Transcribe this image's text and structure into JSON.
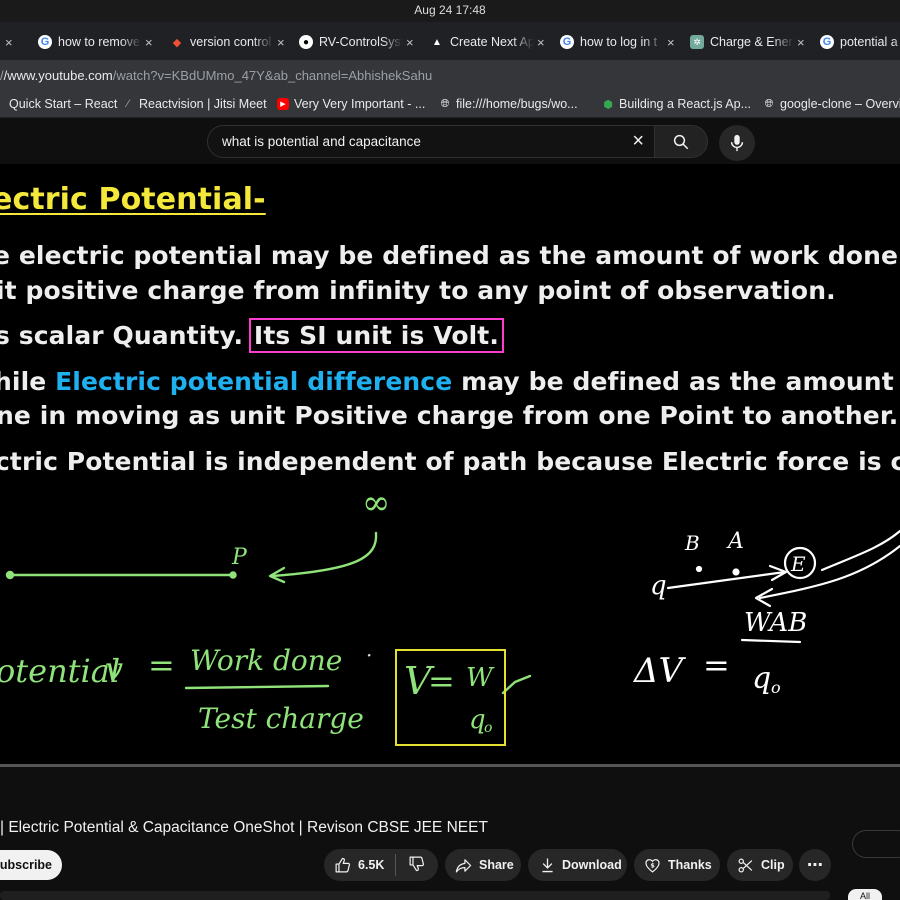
{
  "system": {
    "clock": "Aug 24  17:48"
  },
  "tabs": [
    {
      "icon": "partial-icon",
      "title": "",
      "close": "×"
    },
    {
      "icon": "google-icon",
      "title": "how to remove",
      "close": "×"
    },
    {
      "icon": "git-icon",
      "title": "version control",
      "close": "×"
    },
    {
      "icon": "github-icon",
      "title": "RV-ControlSyst",
      "close": "×"
    },
    {
      "icon": "vercel-icon",
      "title": "Create Next Ap",
      "close": "×"
    },
    {
      "icon": "google-icon",
      "title": "how to log in t",
      "close": "×"
    },
    {
      "icon": "chatgpt-icon",
      "title": "Charge & Energ",
      "close": "×"
    },
    {
      "icon": "google-icon",
      "title": "potential a",
      "close": ""
    }
  ],
  "address": {
    "prefix": "/",
    "host": "/www.youtube.com",
    "path": "/watch?v=KBdUMmo_47Y&ab_channel=AbhishekSahu"
  },
  "bookmarks": [
    {
      "icon": "partial-icon",
      "label": "Quick Start – React"
    },
    {
      "icon": "slash-icon",
      "label": "Reactvision | Jitsi Meet"
    },
    {
      "icon": "youtube-icon",
      "label": "Very Very Important - ..."
    },
    {
      "icon": "globe-icon",
      "label": "file:///home/bugs/wo..."
    },
    {
      "icon": "shield-icon",
      "label": "Building a React.js Ap..."
    },
    {
      "icon": "globe-icon",
      "label": "google-clone – Overvi"
    }
  ],
  "search": {
    "value": "what is potential and capacitance",
    "clear": "×"
  },
  "video_frame": {
    "heading": "ectric Potential-",
    "line1": "e electric potential may be defined as the amount of work done in mo",
    "line2": "it positive charge from infinity to any point of observation.",
    "line3_pre": "s scalar Quantity. ",
    "line3_box": "Its SI unit is Volt.",
    "line4_pre": "hile ",
    "line4_blue": "Electric potential difference",
    "line4_post": " may be defined as the amount of wo",
    "line5": "ne in moving as unit Positive charge from one Point to another.",
    "line6": "ctric Potential is independent of path because Electric force is conser",
    "hand": {
      "infinity": "∞",
      "p": "P",
      "b": "B",
      "a": "A",
      "q": "q",
      "e": "E",
      "potential": "otential",
      "v": "v",
      "eq": "=",
      "work_done": "Work done",
      "test_charge": "Test charge",
      "dot": "·",
      "box_v": "V",
      "box_eq": "=",
      "box_w": "W",
      "box_q": "q",
      "box_sub": "o",
      "delta_v": "ΔV",
      "eq2": "=",
      "wab": "WAB",
      "q0": "q",
      "q0_sub": "o"
    }
  },
  "video": {
    "title": "| Electric Potential & Capacitance OneShot | Revison CBSE JEE NEET",
    "subscribe": "Subscribe",
    "likes": "6.5K",
    "share": "Share",
    "download": "Download",
    "thanks": "Thanks",
    "clip": "Clip",
    "more": "⋯",
    "side_chip": "All"
  },
  "colors": {
    "heading_yellow": "#f4e93a",
    "highlight_blue": "#1fb0f0",
    "box_magenta": "#ff3cd0",
    "chalk_green": "#8fe37a",
    "box_yellow": "#e4e032"
  }
}
